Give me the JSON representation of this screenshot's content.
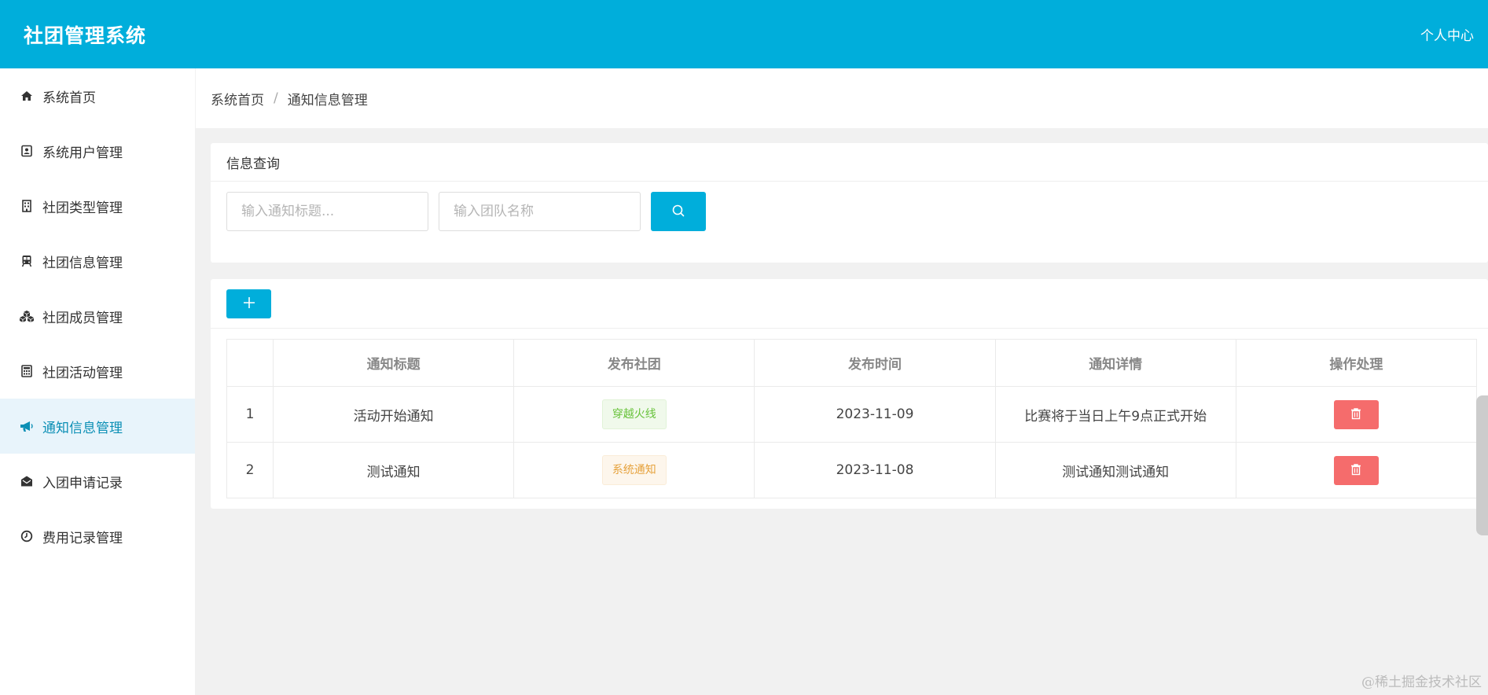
{
  "header": {
    "title": "社团管理系统",
    "user_center": "个人中心"
  },
  "sidebar": {
    "items": [
      {
        "label": "系统首页",
        "icon": "home-icon"
      },
      {
        "label": "系统用户管理",
        "icon": "contact-card-icon"
      },
      {
        "label": "社团类型管理",
        "icon": "building-icon"
      },
      {
        "label": "社团信息管理",
        "icon": "train-icon"
      },
      {
        "label": "社团成员管理",
        "icon": "cubes-icon"
      },
      {
        "label": "社团活动管理",
        "icon": "calculator-icon"
      },
      {
        "label": "通知信息管理",
        "icon": "bullhorn-icon",
        "active": true
      },
      {
        "label": "入团申请记录",
        "icon": "envelope-open-icon"
      },
      {
        "label": "费用记录管理",
        "icon": "clock-icon"
      }
    ]
  },
  "breadcrumb": {
    "home": "系统首页",
    "separator": "/",
    "current": "通知信息管理"
  },
  "query": {
    "header": "信息查询",
    "title_placeholder": "输入通知标题...",
    "team_placeholder": "输入团队名称"
  },
  "table": {
    "columns": [
      "",
      "通知标题",
      "发布社团",
      "发布时间",
      "通知详情",
      "操作处理"
    ],
    "rows": [
      {
        "index": "1",
        "title": "活动开始通知",
        "club": "穿越火线",
        "club_tag_color": "#67c23a",
        "time": "2023-11-09",
        "detail": "比赛将于当日上午9点正式开始"
      },
      {
        "index": "2",
        "title": "测试通知",
        "club": "系统通知",
        "club_tag_color": "#e6a23c",
        "time": "2023-11-08",
        "detail": "测试通知测试通知"
      }
    ]
  },
  "colors": {
    "primary": "#00aedb",
    "danger": "#f56c6c",
    "active_nav_bg": "#e8f4fb"
  },
  "watermark": "@稀土掘金技术社区"
}
